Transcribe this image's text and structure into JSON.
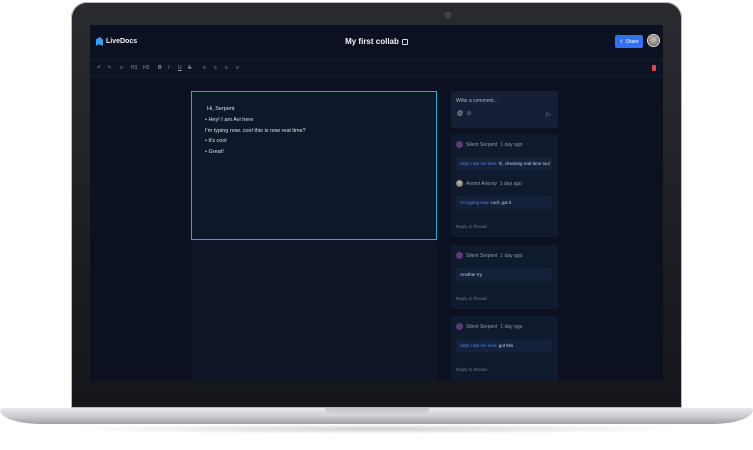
{
  "app": {
    "brand": "LiveDocs",
    "document_title": "My first collab",
    "share_label": "Share"
  },
  "toolbar": {
    "tools": [
      "↶",
      "↷",
      "≡",
      "H1",
      "H2",
      "B",
      "I",
      "U",
      "S",
      "≡",
      "≡",
      "≡",
      "≡"
    ],
    "colors": {
      "accent": "#3371f2",
      "editor_border": "#1fb2c4",
      "danger": "#e0474c"
    }
  },
  "editor": {
    "lines": [
      "Hi, Serpent",
      "• Hey! I am Avi here",
      "I'm typing now. cool this is now real time?",
      "• it's cool",
      "• Great!"
    ]
  },
  "composer": {
    "placeholder": "Write a comment...",
    "icons": [
      "@",
      "☺"
    ],
    "send_icon": "▷"
  },
  "threads": [
    {
      "comments": [
        {
          "author": "Silent Serpent",
          "time": "1 day ago",
          "quote": "Hey! I am Avi here",
          "text": "hi, checking real-time tool"
        },
        {
          "author": "Anmol Antony",
          "time": "1 day ago",
          "quote": "I'm typing now",
          "text": "cool, got it"
        }
      ],
      "reply_placeholder": "Reply to thread..."
    },
    {
      "comments": [
        {
          "author": "Silent Serpent",
          "time": "1 day ago",
          "quote": "",
          "text": "Another try"
        }
      ],
      "reply_placeholder": "Reply to thread..."
    },
    {
      "comments": [
        {
          "author": "Silent Serpent",
          "time": "1 day ago",
          "quote": "Hey! I am Avi here",
          "text": "got this"
        }
      ],
      "reply_placeholder": "Reply to thread..."
    }
  ]
}
